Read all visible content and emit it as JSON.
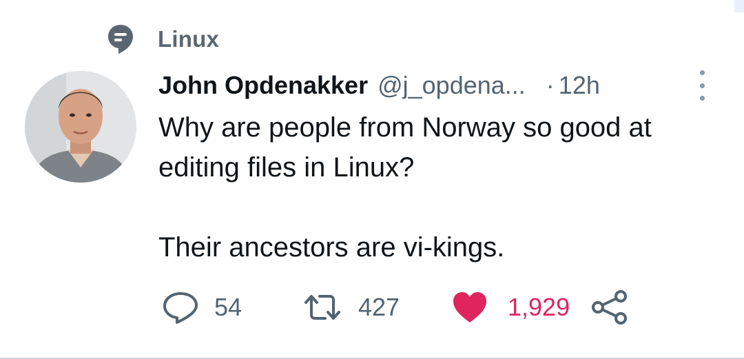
{
  "topic": {
    "label": "Linux",
    "icon": "topic-icon"
  },
  "tweet": {
    "author_name": "John Opdenakker",
    "author_handle": "@j_opdena...",
    "separator": "·",
    "time": "12h",
    "text_line1": "Why are people from Norway so good at",
    "text_line2": "editing files in Linux?",
    "text_line3": "Their ancestors are vi-kings."
  },
  "actions": {
    "replies": "54",
    "retweets": "427",
    "likes": "1,929"
  },
  "colors": {
    "muted": "#536471",
    "like": "#e0245e",
    "topic_icon": "#5b6670"
  }
}
